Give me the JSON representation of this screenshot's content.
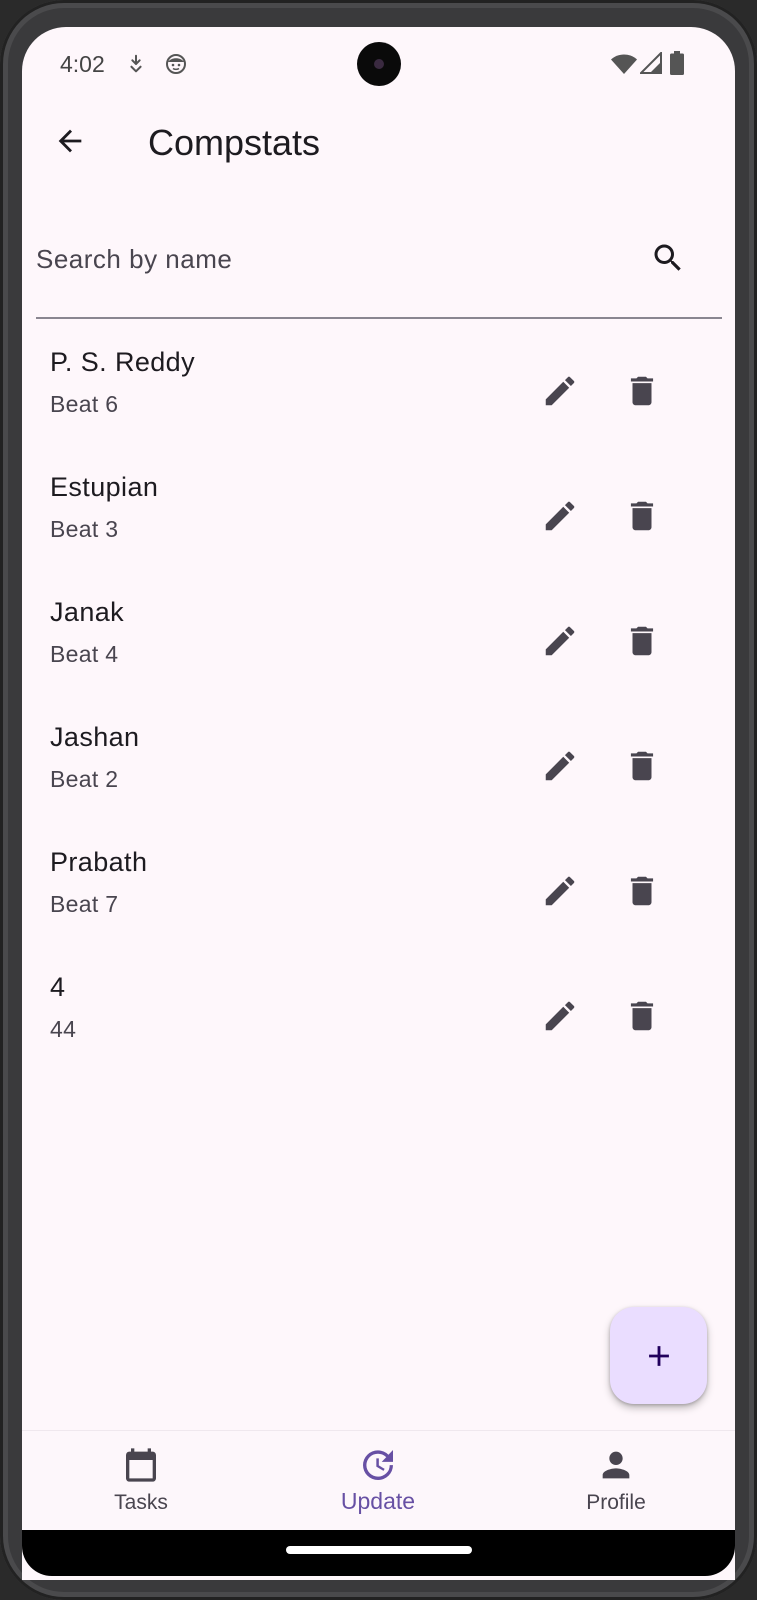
{
  "status_bar": {
    "time": "4:02",
    "icons": [
      "download-status-icon",
      "face-status-icon",
      "wifi-icon",
      "cell-signal-icon",
      "battery-icon"
    ]
  },
  "app_bar": {
    "title": "Compstats",
    "back_icon": "arrow-back-icon"
  },
  "search": {
    "placeholder": "Search by name",
    "value": "",
    "icon": "search-icon"
  },
  "items": [
    {
      "name": "P. S. Reddy",
      "beat": "Beat 6"
    },
    {
      "name": "Estupian",
      "beat": "Beat 3"
    },
    {
      "name": "Janak",
      "beat": "Beat 4"
    },
    {
      "name": "Jashan",
      "beat": "Beat 2"
    },
    {
      "name": "Prabath",
      "beat": "Beat 7"
    },
    {
      "name": "4",
      "beat": "44"
    }
  ],
  "row_actions": {
    "edit_icon": "pencil-icon",
    "delete_icon": "trash-icon"
  },
  "fab": {
    "icon": "plus-icon"
  },
  "bottom_nav": {
    "items": [
      {
        "label": "Tasks",
        "icon": "calendar-icon",
        "active": false
      },
      {
        "label": "Update",
        "icon": "update-clock-icon",
        "active": true
      },
      {
        "label": "Profile",
        "icon": "person-icon",
        "active": false
      }
    ]
  },
  "colors": {
    "background": "#fef7fb",
    "primary": "#6750a4",
    "fab_container": "#eaddff",
    "on_surface": "#1d1b20",
    "on_surface_variant": "#49454f",
    "icon": "#49454f"
  }
}
